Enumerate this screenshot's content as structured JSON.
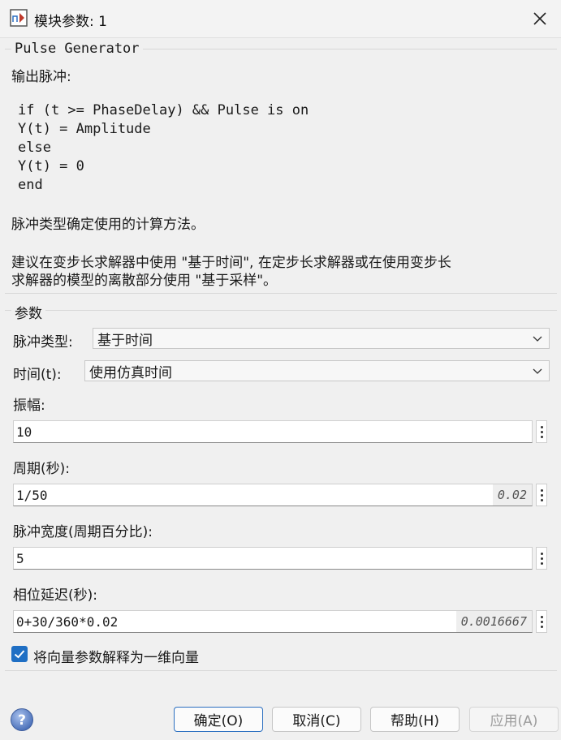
{
  "window": {
    "title": "模块参数: 1",
    "close_icon": "close-icon",
    "app_icon": "simulink-block-icon"
  },
  "description": {
    "block_name": "Pulse Generator",
    "intro": "输出脉冲:",
    "code": [
      "if (t >= PhaseDelay) && Pulse is on",
      "Y(t) = Amplitude",
      "else",
      "Y(t) = 0",
      "end"
    ],
    "line_type": "脉冲类型确定使用的计算方法。",
    "line_suggest_1": "建议在变步长求解器中使用 \"基于时间\", 在定步长求解器或在使用变步长",
    "line_suggest_2": "求解器的模型的离散部分使用 \"基于采样\"。"
  },
  "params": {
    "title": "参数",
    "pulse_type": {
      "label": "脉冲类型:",
      "value": "基于时间"
    },
    "time": {
      "label": "时间(t):",
      "value": "使用仿真时间"
    },
    "amplitude": {
      "label": "振幅:",
      "value": "10"
    },
    "period": {
      "label": "周期(秒):",
      "value": "1/50",
      "evaluated": "0.02"
    },
    "pulse_width": {
      "label": "脉冲宽度(周期百分比):",
      "value": "5"
    },
    "phase_delay": {
      "label": "相位延迟(秒):",
      "value": "0+30/360*0.02",
      "evaluated": "0.0016667"
    },
    "vector_1d": {
      "label": "将向量参数解释为一维向量",
      "checked": true
    }
  },
  "buttons": {
    "ok": "确定(O)",
    "cancel": "取消(C)",
    "help": "帮助(H)",
    "apply": "应用(A)"
  },
  "colors": {
    "accent": "#1f6fc4",
    "help_icon": "#5a7fc0"
  }
}
